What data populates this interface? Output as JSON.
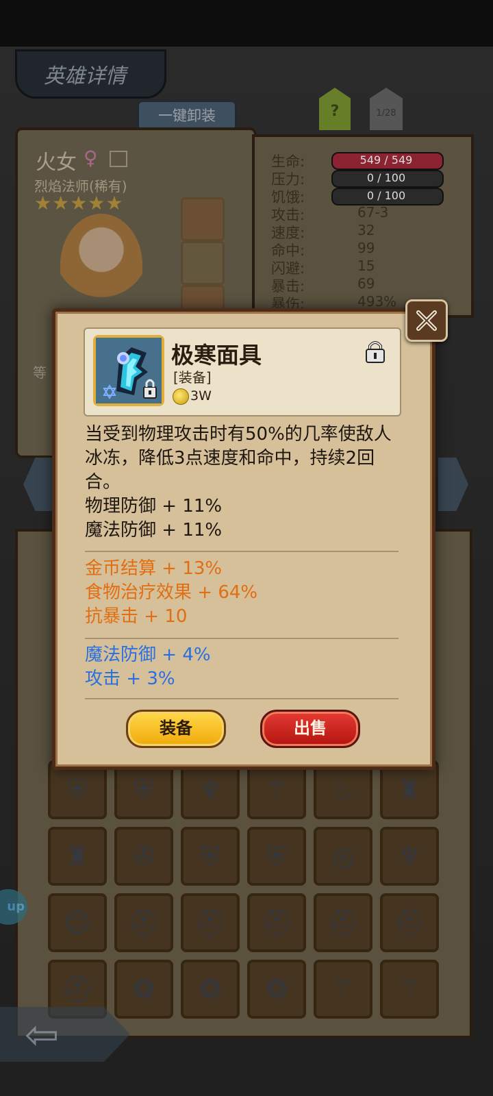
{
  "screen_title": "英雄详情",
  "unequip_all_label": "一键卸装",
  "help_label": "?",
  "page_counter": "1/28",
  "hero": {
    "name": "火女",
    "gender_symbol": "♀",
    "class": "烈焰法师(稀有)",
    "stars": "★★★★★",
    "level_label": "等"
  },
  "stats": [
    {
      "label": "生命:",
      "value": "549 / 549",
      "bar": "red"
    },
    {
      "label": "压力:",
      "value": "0 / 100",
      "bar": "dark"
    },
    {
      "label": "饥饿:",
      "value": "0 / 100",
      "bar": "dark"
    },
    {
      "label": "攻击:",
      "value": "67-3"
    },
    {
      "label": "速度:",
      "value": "32"
    },
    {
      "label": "命中:",
      "value": "99"
    },
    {
      "label": "闪避:",
      "value": "15"
    },
    {
      "label": "暴击:",
      "value": "69"
    },
    {
      "label": "暴伤:",
      "value": "493%"
    }
  ],
  "item": {
    "name": "极寒面具",
    "type": "[装备]",
    "price": "3W",
    "description": "当受到物理攻击时有50%的几率使敌人冰冻，降低3点速度和命中，持续2回合。",
    "base_stats": [
      "物理防御 + 11%",
      "魔法防御 + 11%"
    ],
    "bonus_stats": [
      "金币结算 + 13%",
      "食物治疗效果 + 64%",
      "抗暴击 + 10"
    ],
    "enchant_stats": [
      "魔法防御 + 4%",
      "攻击 + 3%"
    ]
  },
  "buttons": {
    "equip": "装备",
    "sell": "出售"
  },
  "up_badge": "up",
  "colors": {
    "orange_stat": "#e06e12",
    "blue_stat": "#2a6fe0",
    "equip_button": "#f0a90a",
    "sell_button": "#c91c16"
  },
  "inventory_icons": [
    "shield-icon",
    "shield-icon",
    "frost-mask-icon",
    "dragon-staff-icon",
    "potion-bag-icon",
    "gold-armor-icon",
    "gold-armor-icon",
    "pendant-icon",
    "shield-icon",
    "shield-icon",
    "ring-icon",
    "frost-mask-icon",
    "voodoo-doll-icon",
    "helmet-icon",
    "helmet-icon",
    "helmet-icon",
    "helmet-icon",
    "helmet-icon",
    "helmet-icon",
    "fire-ring-icon",
    "fire-ring-icon",
    "fire-ring-icon",
    "dragon-staff-icon",
    "dragon-staff-icon"
  ]
}
